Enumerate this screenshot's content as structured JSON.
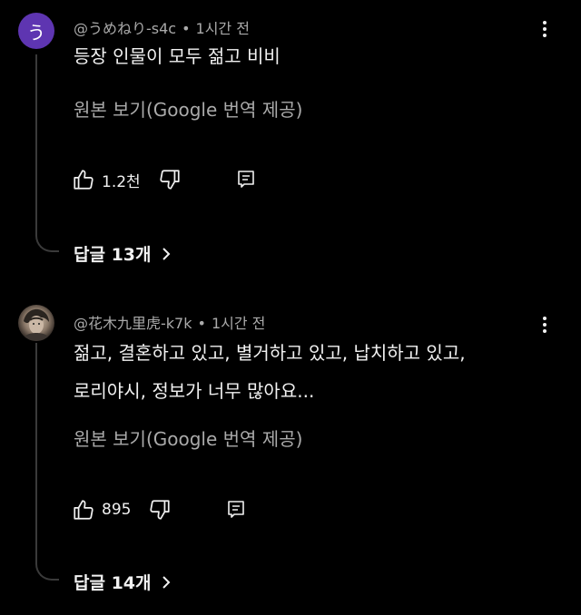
{
  "colors": {
    "background": "#000000",
    "text_primary": "#f1f1f1",
    "text_secondary": "#aaaaaa",
    "avatar_1": "#5e35b1",
    "thread_line": "#3a3a3a"
  },
  "comments": [
    {
      "avatar_letter": "う",
      "author": "@うめねり-s4c",
      "separator": "•",
      "time": "1시간 전",
      "lines": [
        "등장 인물이 모두 젊고 비비"
      ],
      "translate_label": "원본 보기(Google 번역 제공)",
      "like_icon": "thumb-up-icon",
      "likes": "1.2천",
      "dislike_icon": "thumb-down-icon",
      "reply_icon": "reply-icon",
      "replies_label": "답글 13개",
      "replies_chevron": "chevron-right-icon",
      "menu_icon": "more-vert-icon"
    },
    {
      "avatar_letter": "",
      "author": "@花木九里虎-k7k",
      "separator": "•",
      "time": "1시간 전",
      "lines": [
        "젊고, 결혼하고 있고, 별거하고 있고, 납치하고 있고,",
        "로리야시, 정보가 너무 많아요..."
      ],
      "translate_label": "원본 보기(Google 번역 제공)",
      "like_icon": "thumb-up-icon",
      "likes": "895",
      "dislike_icon": "thumb-down-icon",
      "reply_icon": "reply-icon",
      "replies_label": "답글 14개",
      "replies_chevron": "chevron-right-icon",
      "menu_icon": "more-vert-icon"
    }
  ]
}
